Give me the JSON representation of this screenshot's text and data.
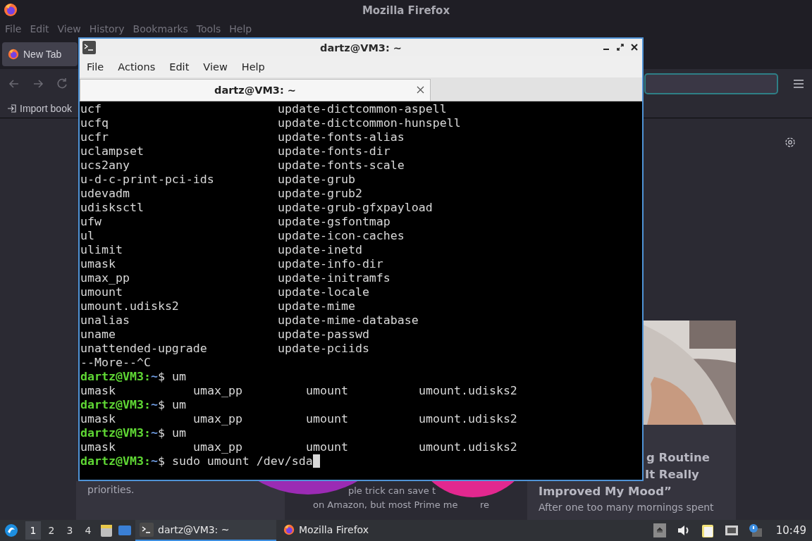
{
  "firefox": {
    "title": "Mozilla Firefox",
    "menu": [
      "File",
      "Edit",
      "View",
      "History",
      "Bookmarks",
      "Tools",
      "Help"
    ],
    "tabs": [
      {
        "label": "New Tab",
        "selected": true
      }
    ],
    "bookmarks": [
      {
        "label": "Import book"
      }
    ],
    "cards": [
      {
        "lines": [
          "priorities."
        ]
      },
      {
        "lines": [
          "ple trick can save t"
        ],
        "split_line": [
          "on Amazon, but most Prime me",
          "re"
        ]
      },
      {
        "kind": "picture",
        "title_tail": [
          "g Routine",
          "It Really"
        ],
        "title": "Improved My Mood”",
        "summary": "After one too many mornings spent"
      }
    ]
  },
  "terminal": {
    "title": "dartz@VM3: ~",
    "menu": [
      "File",
      "Actions",
      "Edit",
      "View",
      "Help"
    ],
    "tabs": [
      {
        "label": "dartz@VM3: ~",
        "selected": true
      }
    ],
    "listing": [
      [
        "ucf",
        "update-dictcommon-aspell"
      ],
      [
        "ucfq",
        "update-dictcommon-hunspell"
      ],
      [
        "ucfr",
        "update-fonts-alias"
      ],
      [
        "uclampset",
        "update-fonts-dir"
      ],
      [
        "ucs2any",
        "update-fonts-scale"
      ],
      [
        "u-d-c-print-pci-ids",
        "update-grub"
      ],
      [
        "udevadm",
        "update-grub2"
      ],
      [
        "udisksctl",
        "update-grub-gfxpayload"
      ],
      [
        "ufw",
        "update-gsfontmap"
      ],
      [
        "ul",
        "update-icon-caches"
      ],
      [
        "ulimit",
        "update-inetd"
      ],
      [
        "umask",
        "update-info-dir"
      ],
      [
        "umax_pp",
        "update-initramfs"
      ],
      [
        "umount",
        "update-locale"
      ],
      [
        "umount.udisks2",
        "update-mime"
      ],
      [
        "unalias",
        "update-mime-database"
      ],
      [
        "uname",
        "update-passwd"
      ],
      [
        "unattended-upgrade",
        "update-pciids"
      ]
    ],
    "lines": [
      {
        "kind": "text",
        "text": "--More--^C"
      },
      {
        "kind": "prompt",
        "host": "dartz@VM3:",
        "path": "~",
        "symbol": "$",
        "command": "um",
        "cursor": false
      },
      {
        "kind": "columns",
        "cells": [
          "umask",
          "umax_pp",
          "umount",
          "umount.udisks2"
        ]
      },
      {
        "kind": "prompt",
        "host": "dartz@VM3:",
        "path": "~",
        "symbol": "$",
        "command": "um",
        "cursor": false
      },
      {
        "kind": "columns",
        "cells": [
          "umask",
          "umax_pp",
          "umount",
          "umount.udisks2"
        ]
      },
      {
        "kind": "prompt",
        "host": "dartz@VM3:",
        "path": "~",
        "symbol": "$",
        "command": "um",
        "cursor": false
      },
      {
        "kind": "columns",
        "cells": [
          "umask",
          "umax_pp",
          "umount",
          "umount.udisks2"
        ]
      },
      {
        "kind": "prompt",
        "host": "dartz@VM3:",
        "path": "~",
        "symbol": "$",
        "command": "sudo umount /dev/sda",
        "cursor": true
      }
    ]
  },
  "taskbar": {
    "workspaces": [
      {
        "label": "1",
        "selected": true
      },
      {
        "label": "2",
        "selected": false
      },
      {
        "label": "3",
        "selected": false
      },
      {
        "label": "4",
        "selected": false
      }
    ],
    "tasks": [
      {
        "kind": "terminal",
        "label": "dartz@VM3: ~",
        "selected": true
      },
      {
        "kind": "firefox",
        "label": "Mozilla Firefox",
        "selected": false
      }
    ],
    "clock": "10:49"
  }
}
